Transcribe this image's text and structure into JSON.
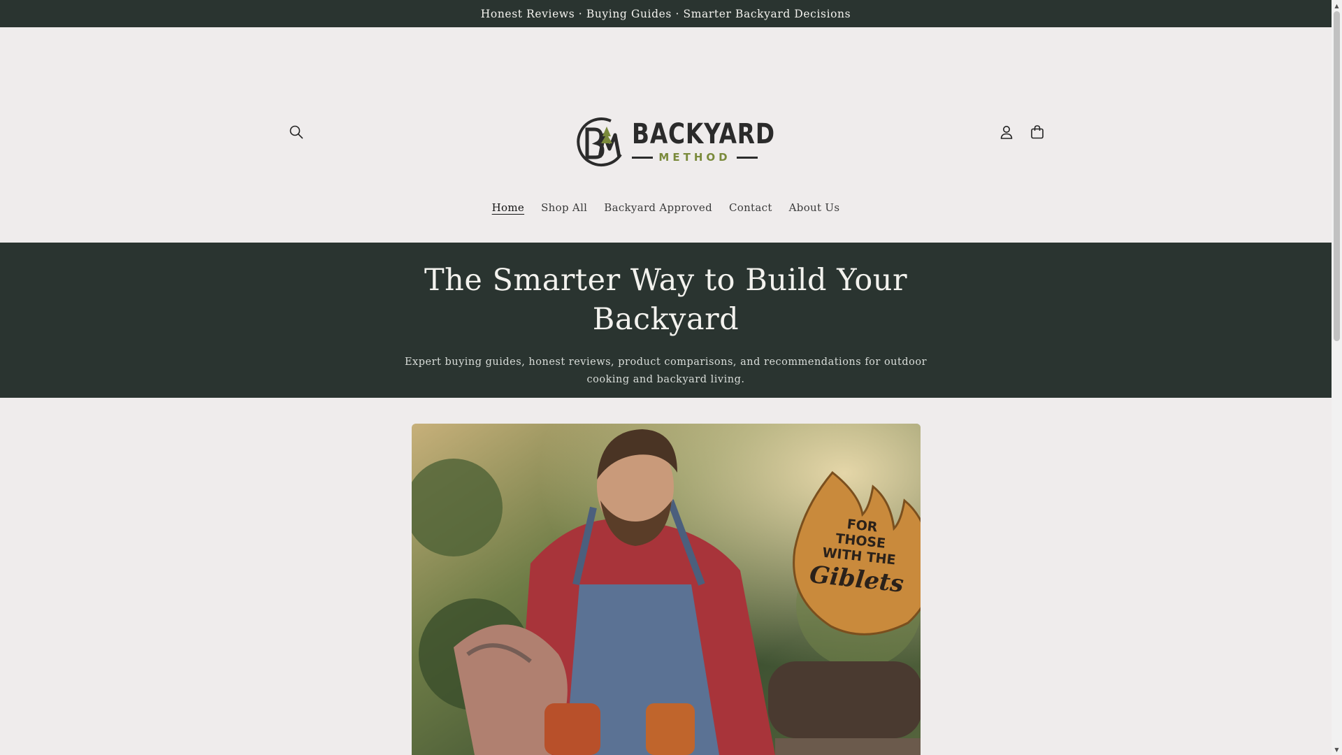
{
  "announcement": {
    "text": "Honest Reviews · Buying Guides · Smarter Backyard Decisions"
  },
  "header": {
    "logo": {
      "word1": "BACKYARD",
      "word2": "METHOD",
      "monogram": "BM"
    },
    "icons": {
      "search": "search-icon",
      "account": "user-icon",
      "cart": "cart-icon"
    }
  },
  "nav": {
    "items": [
      {
        "label": "Home",
        "active": true
      },
      {
        "label": "Shop All"
      },
      {
        "label": "Backyard Approved"
      },
      {
        "label": "Contact"
      },
      {
        "label": "About Us"
      }
    ]
  },
  "hero": {
    "title": "The Smarter Way to Build Your Backyard",
    "subtitle": "Expert buying guides, honest reviews, product comparisons, and recommendations for outdoor cooking and backyard living.",
    "badge_line1": "FOR",
    "badge_line2": "THOSE",
    "badge_line3": "WITH THE",
    "badge_line4": "Giblets"
  },
  "colors": {
    "dark_band": "#2a3430",
    "background": "#efecec",
    "logo_green": "#7a8a3b",
    "badge_orange": "#c98a3c"
  }
}
